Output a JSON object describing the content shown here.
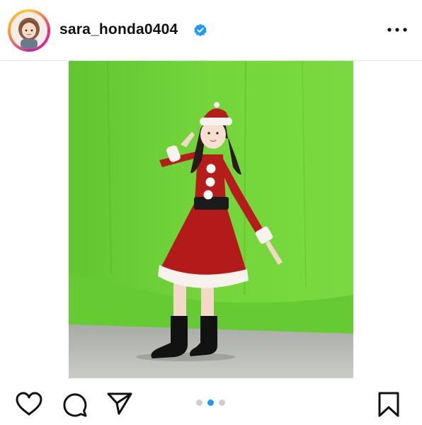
{
  "post": {
    "username": "sara_honda0404",
    "verified": true,
    "avatar_icon": "profile-avatar-icon",
    "more_icon": "more-options-icon"
  },
  "media": {
    "carousel_index": 2,
    "carousel_count": 3,
    "description": ""
  },
  "actions": {
    "like_icon": "heart-icon",
    "comment_icon": "comment-icon",
    "share_icon": "send-icon",
    "save_icon": "bookmark-icon"
  },
  "colors": {
    "verified_blue": "#1d9bf0",
    "active_dot": "#1d9bf0",
    "inactive_dot": "#cfcfcf",
    "ring_gradient_start": "#f9ce34",
    "ring_gradient_end": "#ee2a7b"
  }
}
